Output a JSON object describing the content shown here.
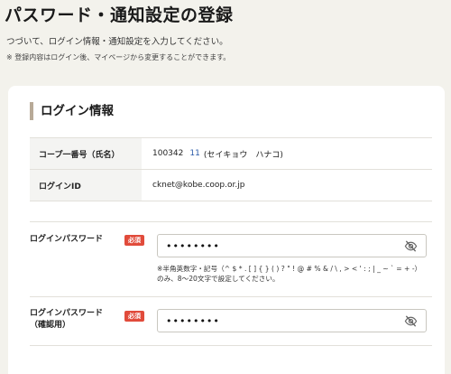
{
  "page": {
    "title": "パスワード・通知設定の登録",
    "intro": "つづいて、ログイン情報・通知設定を入力してください。",
    "note": "※ 登録内容はログイン後、マイページから変更することができます。"
  },
  "login_section": {
    "heading": "ログイン情報",
    "rows": [
      {
        "label": "コープ一番号（氏名）",
        "member_no": "100342",
        "branch_no": "11",
        "name": "(セイキョウ　ハナコ)"
      },
      {
        "label": "ログインID",
        "value": "cknet@kobe.coop.or.jp"
      }
    ]
  },
  "password": {
    "label": "ログインパスワード",
    "required_badge": "必須",
    "masked_value": "••••••••",
    "hint": "※半角英数字・記号（^ $ * . [ ] { } ( ) ? \" ! @ # % & / \\ , > < ' : ; | _ ~ ` = + -）のみ、8〜20文字で設定してください。",
    "eye_icon": "eye-slash-icon"
  },
  "password_confirm": {
    "label_line1": "ログインパスワード",
    "label_line2": "（確認用）",
    "required_badge": "必須",
    "masked_value": "••••••••",
    "eye_icon": "eye-slash-icon"
  },
  "colors": {
    "background": "#f3f2ec",
    "card": "#ffffff",
    "required_badge": "#e14b3b",
    "section_accent": "#b8aa98",
    "member_number": "#2a5aa8"
  }
}
